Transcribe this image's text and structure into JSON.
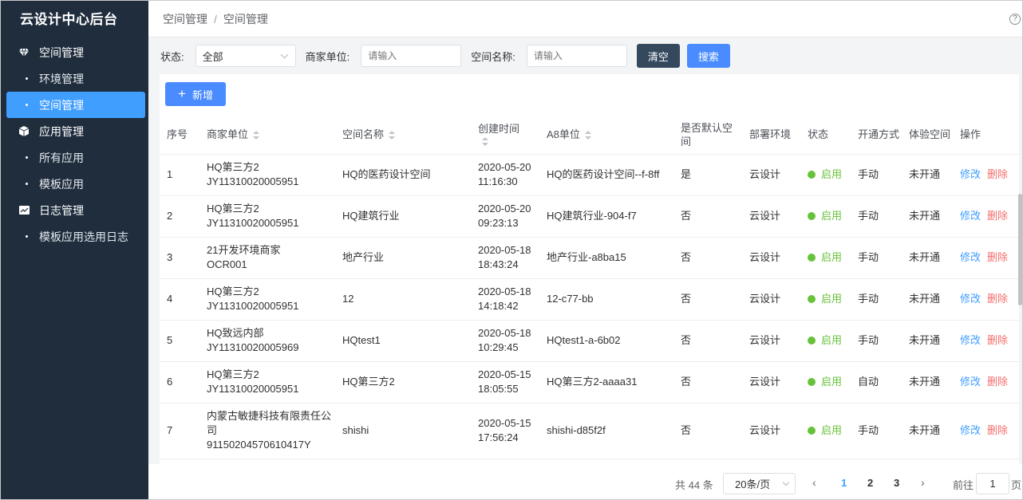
{
  "sidebar": {
    "brand": "云设计中心后台",
    "groups": [
      {
        "label": "空间管理",
        "icon": "diamond-icon",
        "items": [
          {
            "label": "环境管理",
            "active": false
          },
          {
            "label": "空间管理",
            "active": true
          }
        ]
      },
      {
        "label": "应用管理",
        "icon": "cube-icon",
        "items": [
          {
            "label": "所有应用",
            "active": false
          },
          {
            "label": "模板应用",
            "active": false
          }
        ]
      },
      {
        "label": "日志管理",
        "icon": "log-icon",
        "items": [
          {
            "label": "模板应用选用日志",
            "active": false
          }
        ]
      }
    ]
  },
  "header": {
    "breadcrumb": [
      "空间管理",
      "空间管理"
    ],
    "separator": "/",
    "help_glyph": "?"
  },
  "filters": {
    "status_label": "状态:",
    "status_value": "全部",
    "merchant_label": "商家单位:",
    "merchant_placeholder": "请输入",
    "space_label": "空间名称:",
    "space_placeholder": "请输入",
    "clear_label": "清空",
    "search_label": "搜索"
  },
  "toolbar": {
    "add_label": "新增",
    "add_glyph": "+"
  },
  "table": {
    "columns": [
      "序号",
      "商家单位",
      "空间名称",
      "创建时间",
      "A8单位",
      "是否默认空间",
      "部署环境",
      "状态",
      "开通方式",
      "体验空间",
      "操作"
    ],
    "edit_label": "修改",
    "delete_label": "删除",
    "rows": [
      {
        "no": "1",
        "merchant_name": "HQ第三方2",
        "merchant_code": "JY11310020005951",
        "space": "HQ的医药设计空间",
        "date": "2020-05-20",
        "time": "11:16:30",
        "a8": "HQ的医药设计空间--f-8ff",
        "default": "是",
        "env": "云设计",
        "status": "启用",
        "mode": "手动",
        "trial": "未开通"
      },
      {
        "no": "2",
        "merchant_name": "HQ第三方2",
        "merchant_code": "JY11310020005951",
        "space": "HQ建筑行业",
        "date": "2020-05-20",
        "time": "09:23:13",
        "a8": "HQ建筑行业-904-f7",
        "default": "否",
        "env": "云设计",
        "status": "启用",
        "mode": "手动",
        "trial": "未开通"
      },
      {
        "no": "3",
        "merchant_name": "21开发环境商家",
        "merchant_code": "OCR001",
        "space": "地产行业",
        "date": "2020-05-18",
        "time": "18:43:24",
        "a8": "地产行业-a8ba15",
        "default": "否",
        "env": "云设计",
        "status": "启用",
        "mode": "手动",
        "trial": "未开通"
      },
      {
        "no": "4",
        "merchant_name": "HQ第三方2",
        "merchant_code": "JY11310020005951",
        "space": "12",
        "date": "2020-05-18",
        "time": "14:18:42",
        "a8": "12-c77-bb",
        "default": "否",
        "env": "云设计",
        "status": "启用",
        "mode": "手动",
        "trial": "未开通"
      },
      {
        "no": "5",
        "merchant_name": "HQ致远内部",
        "merchant_code": "JY11310020005969",
        "space": "HQtest1",
        "date": "2020-05-18",
        "time": "10:29:45",
        "a8": "HQtest1-a-6b02",
        "default": "否",
        "env": "云设计",
        "status": "启用",
        "mode": "手动",
        "trial": "未开通"
      },
      {
        "no": "6",
        "merchant_name": "HQ第三方2",
        "merchant_code": "JY11310020005951",
        "space": "HQ第三方2",
        "date": "2020-05-15",
        "time": "18:05:55",
        "a8": "HQ第三方2-aaaa31",
        "default": "否",
        "env": "云设计",
        "status": "启用",
        "mode": "自动",
        "trial": "未开通"
      },
      {
        "no": "7",
        "merchant_name": "内蒙古敏捷科技有限责任公司",
        "merchant_code": "91150204570610417Y",
        "space": "shishi",
        "date": "2020-05-15",
        "time": "17:56:24",
        "a8": "shishi-d85f2f",
        "default": "否",
        "env": "云设计",
        "status": "启用",
        "mode": "手动",
        "trial": "未开通"
      }
    ]
  },
  "pagination": {
    "total": "共 44 条",
    "page_size": "20条/页",
    "pages": [
      "1",
      "2",
      "3"
    ],
    "current": "1",
    "prev": "‹",
    "next": "›",
    "goto_label": "前往",
    "goto_value": "1",
    "page_suffix": "页"
  },
  "colors": {
    "sidebar_bg": "#1f2d3d",
    "accent": "#409eff",
    "success": "#67c23a",
    "danger": "#f56c6c"
  }
}
